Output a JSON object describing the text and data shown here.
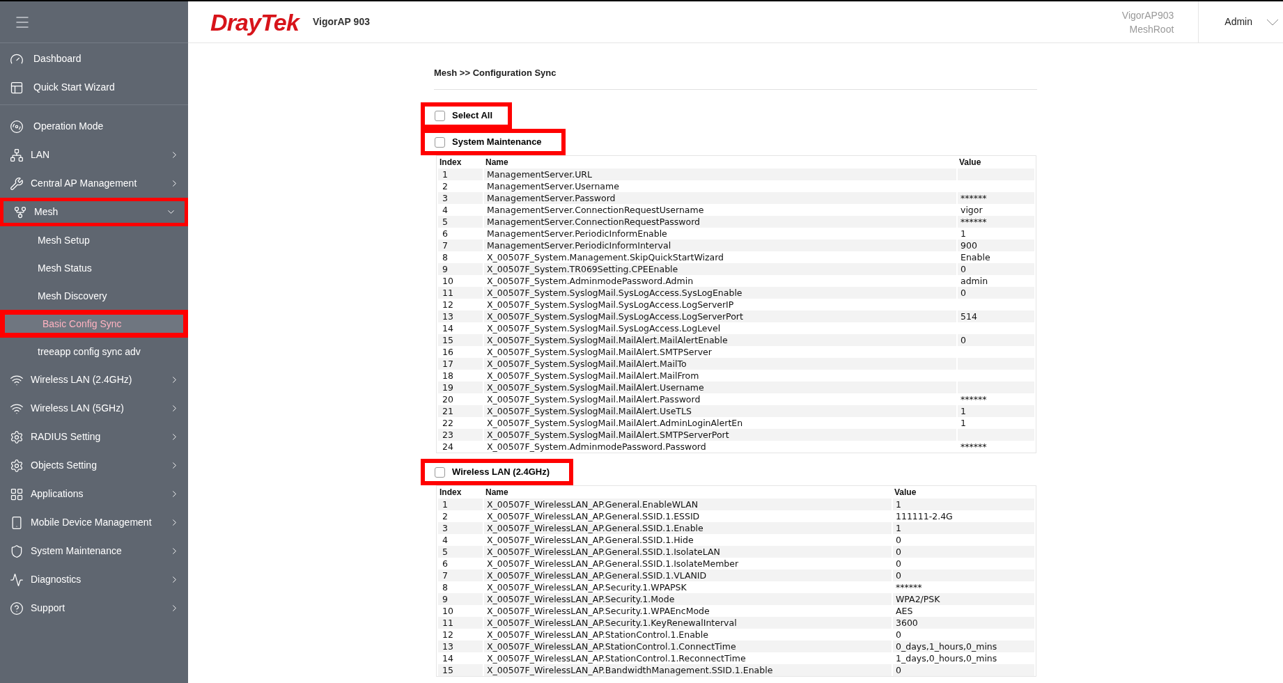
{
  "header": {
    "logo": "DrayTek",
    "model": "VigorAP 903",
    "device_name": "VigorAP903",
    "device_role": "MeshRoot",
    "user": "Admin"
  },
  "sidebar": {
    "sections": [
      [
        {
          "label": "Dashboard",
          "kind": "link",
          "highlighted": false
        },
        {
          "label": "Quick Start Wizard",
          "kind": "link",
          "highlighted": false
        }
      ],
      [
        {
          "label": "Operation Mode",
          "kind": "link",
          "highlighted": false
        },
        {
          "label": "LAN",
          "kind": "menu",
          "expanded": false,
          "highlighted": false
        },
        {
          "label": "Central AP Management",
          "kind": "menu",
          "expanded": false,
          "highlighted": false
        },
        {
          "label": "Mesh",
          "kind": "menu",
          "expanded": true,
          "highlighted": true,
          "children": [
            {
              "label": "Mesh Setup",
              "selected": false,
              "highlighted": false
            },
            {
              "label": "Mesh Status",
              "selected": false,
              "highlighted": false
            },
            {
              "label": "Mesh Discovery",
              "selected": false,
              "highlighted": false
            },
            {
              "label": "Basic Config Sync",
              "selected": true,
              "highlighted": true
            },
            {
              "label": "treeapp config sync adv",
              "selected": false,
              "highlighted": false
            }
          ]
        },
        {
          "label": "Wireless LAN (2.4GHz)",
          "kind": "menu",
          "expanded": false,
          "highlighted": false
        },
        {
          "label": "Wireless LAN (5GHz)",
          "kind": "menu",
          "expanded": false,
          "highlighted": false
        },
        {
          "label": "RADIUS Setting",
          "kind": "menu",
          "expanded": false,
          "highlighted": false
        },
        {
          "label": "Objects Setting",
          "kind": "menu",
          "expanded": false,
          "highlighted": false
        },
        {
          "label": "Applications",
          "kind": "menu",
          "expanded": false,
          "highlighted": false
        },
        {
          "label": "Mobile Device Management",
          "kind": "menu",
          "expanded": false,
          "highlighted": false
        },
        {
          "label": "System Maintenance",
          "kind": "menu",
          "expanded": false,
          "highlighted": false
        },
        {
          "label": "Diagnostics",
          "kind": "menu",
          "expanded": false,
          "highlighted": false
        },
        {
          "label": "Support",
          "kind": "menu",
          "expanded": false,
          "highlighted": false
        }
      ]
    ]
  },
  "breadcrumb": "Mesh >> Configuration Sync",
  "select_all": {
    "label": "Select All",
    "checked": false,
    "highlighted": true
  },
  "sections": [
    {
      "title": "System Maintenance",
      "checked": false,
      "highlighted": true,
      "columns": [
        "Index",
        "Name",
        "Value"
      ],
      "rows": [
        [
          "1",
          "ManagementServer.URL",
          ""
        ],
        [
          "2",
          "ManagementServer.Username",
          ""
        ],
        [
          "3",
          "ManagementServer.Password",
          "******"
        ],
        [
          "4",
          "ManagementServer.ConnectionRequestUsername",
          "vigor"
        ],
        [
          "5",
          "ManagementServer.ConnectionRequestPassword",
          "******"
        ],
        [
          "6",
          "ManagementServer.PeriodicInformEnable",
          "1"
        ],
        [
          "7",
          "ManagementServer.PeriodicInformInterval",
          "900"
        ],
        [
          "8",
          "X_00507F_System.Management.SkipQuickStartWizard",
          "Enable"
        ],
        [
          "9",
          "X_00507F_System.TR069Setting.CPEEnable",
          "0"
        ],
        [
          "10",
          "X_00507F_System.AdminmodePassword.Admin",
          "admin"
        ],
        [
          "11",
          "X_00507F_System.SyslogMail.SysLogAccess.SysLogEnable",
          "0"
        ],
        [
          "12",
          "X_00507F_System.SyslogMail.SysLogAccess.LogServerIP",
          ""
        ],
        [
          "13",
          "X_00507F_System.SyslogMail.SysLogAccess.LogServerPort",
          "514"
        ],
        [
          "14",
          "X_00507F_System.SyslogMail.SysLogAccess.LogLevel",
          ""
        ],
        [
          "15",
          "X_00507F_System.SyslogMail.MailAlert.MailAlertEnable",
          "0"
        ],
        [
          "16",
          "X_00507F_System.SyslogMail.MailAlert.SMTPServer",
          ""
        ],
        [
          "17",
          "X_00507F_System.SyslogMail.MailAlert.MailTo",
          ""
        ],
        [
          "18",
          "X_00507F_System.SyslogMail.MailAlert.MailFrom",
          ""
        ],
        [
          "19",
          "X_00507F_System.SyslogMail.MailAlert.Username",
          ""
        ],
        [
          "20",
          "X_00507F_System.SyslogMail.MailAlert.Password",
          "******"
        ],
        [
          "21",
          "X_00507F_System.SyslogMail.MailAlert.UseTLS",
          "1"
        ],
        [
          "22",
          "X_00507F_System.SyslogMail.MailAlert.AdminLoginAlertEn",
          "1"
        ],
        [
          "23",
          "X_00507F_System.SyslogMail.MailAlert.SMTPServerPort",
          ""
        ],
        [
          "24",
          "X_00507F_System.AdminmodePassword.Password",
          "******"
        ]
      ]
    },
    {
      "title": "Wireless LAN (2.4GHz)",
      "checked": false,
      "highlighted": true,
      "columns": [
        "Index",
        "Name",
        "Value"
      ],
      "rows": [
        [
          "1",
          "X_00507F_WirelessLAN_AP.General.EnableWLAN",
          "1"
        ],
        [
          "2",
          "X_00507F_WirelessLAN_AP.General.SSID.1.ESSID",
          "111111-2.4G"
        ],
        [
          "3",
          "X_00507F_WirelessLAN_AP.General.SSID.1.Enable",
          "1"
        ],
        [
          "4",
          "X_00507F_WirelessLAN_AP.General.SSID.1.Hide",
          "0"
        ],
        [
          "5",
          "X_00507F_WirelessLAN_AP.General.SSID.1.IsolateLAN",
          "0"
        ],
        [
          "6",
          "X_00507F_WirelessLAN_AP.General.SSID.1.IsolateMember",
          "0"
        ],
        [
          "7",
          "X_00507F_WirelessLAN_AP.General.SSID.1.VLANID",
          "0"
        ],
        [
          "8",
          "X_00507F_WirelessLAN_AP.Security.1.WPAPSK",
          "******"
        ],
        [
          "9",
          "X_00507F_WirelessLAN_AP.Security.1.Mode",
          "WPA2/PSK"
        ],
        [
          "10",
          "X_00507F_WirelessLAN_AP.Security.1.WPAEncMode",
          "AES"
        ],
        [
          "11",
          "X_00507F_WirelessLAN_AP.Security.1.KeyRenewalInterval",
          "3600"
        ],
        [
          "12",
          "X_00507F_WirelessLAN_AP.StationControl.1.Enable",
          "0"
        ],
        [
          "13",
          "X_00507F_WirelessLAN_AP.StationControl.1.ConnectTime",
          "0_days,1_hours,0_mins"
        ],
        [
          "14",
          "X_00507F_WirelessLAN_AP.StationControl.1.ReconnectTime",
          "1_days,0_hours,0_mins"
        ],
        [
          "15",
          "X_00507F_WirelessLAN_AP.BandwidthManagement.SSID.1.Enable",
          "0"
        ]
      ]
    }
  ]
}
